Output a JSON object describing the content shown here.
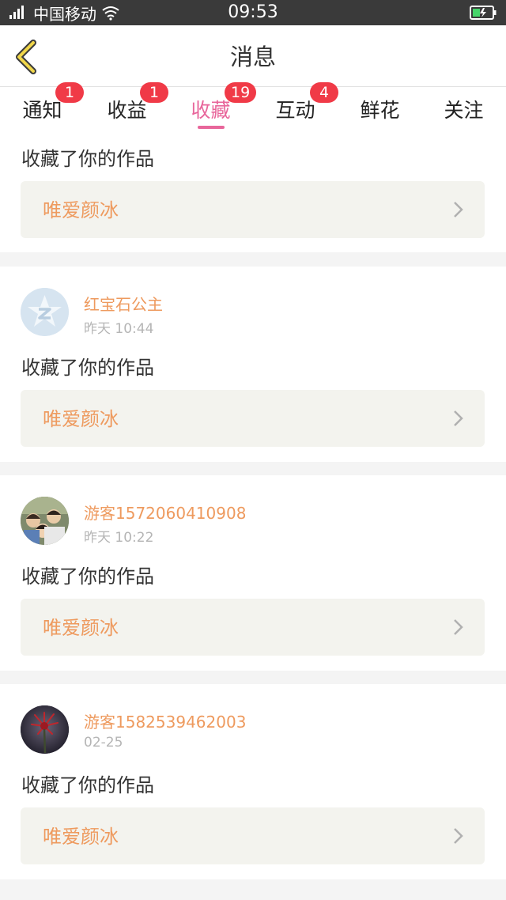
{
  "status_bar": {
    "carrier": "中国移动",
    "time": "09:53"
  },
  "header": {
    "title": "消息"
  },
  "tabs": [
    {
      "label": "通知",
      "badge": "1"
    },
    {
      "label": "收益",
      "badge": "1"
    },
    {
      "label": "收藏",
      "badge": "19"
    },
    {
      "label": "互动",
      "badge": "4"
    },
    {
      "label": "鲜花",
      "badge": ""
    },
    {
      "label": "关注",
      "badge": ""
    }
  ],
  "items": [
    {
      "action": "收藏了你的作品",
      "work": "唯爱颜冰"
    },
    {
      "user": "红宝石公主",
      "time": "昨天 10:44",
      "action": "收藏了你的作品",
      "work": "唯爱颜冰"
    },
    {
      "user": "游客1572060410908",
      "time": "昨天 10:22",
      "action": "收藏了你的作品",
      "work": "唯爱颜冰"
    },
    {
      "user": "游客1582539462003",
      "time": "02-25",
      "action": "收藏了你的作品",
      "work": "唯爱颜冰"
    }
  ],
  "colors": {
    "accent": "#e8669b",
    "badge": "#f03a47",
    "link": "#ee9a5e",
    "back_icon": "#f0d64a"
  }
}
